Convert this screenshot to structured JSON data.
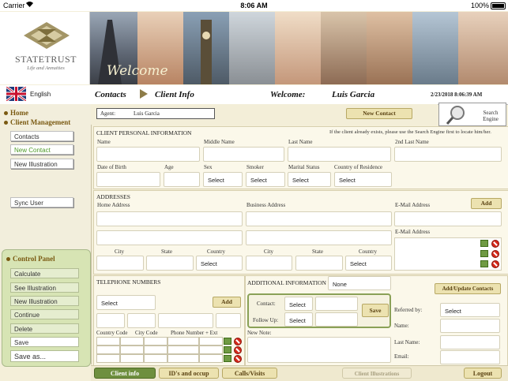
{
  "status_bar": {
    "carrier": "Carrier",
    "time": "8:06 AM",
    "battery": "100%"
  },
  "logo": {
    "name": "STATETRUST",
    "tagline": "Life and Annuities"
  },
  "banner": {
    "welcome_text": "Welcome"
  },
  "topbar": {
    "language": "English",
    "breadcrumb_1": "Contacts",
    "breadcrumb_2": "Client Info",
    "welcome_label": "Welcome:",
    "user_name": "Luis Garcia",
    "datetime": "2/23/2018 8:06:39 AM"
  },
  "sidebar": {
    "home": "Home",
    "client_management": "Client Management",
    "items": [
      "Contacts",
      "New Contact",
      "New Illustration"
    ],
    "sync_user": "Sync User"
  },
  "control_panel": {
    "title": "Control Panel",
    "items": [
      "Calculate",
      "See Illustration",
      "New Illustration",
      "Continue",
      "Delete",
      "Save",
      "Save as..."
    ]
  },
  "agent": {
    "label": "Agent:",
    "value": "Luis Garcia"
  },
  "buttons": {
    "new_contact": "New Contact",
    "search_engine": "Search Engine",
    "add_address": "Add",
    "add_phone": "Add",
    "save_followup": "Save",
    "add_update_contacts": "Add/Update Contacts"
  },
  "personal_info": {
    "title": "CLIENT PERSONAL INFORMATION",
    "note": "If the client already exists, please use the Search Engine first to locate him/her.",
    "name": "Name",
    "middle_name": "Middle Name",
    "last_name": "Last Name",
    "second_last_name": "2nd Last Name",
    "dob": "Date of Birth",
    "age": "Age",
    "sex": "Sex",
    "smoker": "Smoker",
    "marital_status": "Marital Status",
    "country_residence": "Country of Residence",
    "select": "Select"
  },
  "addresses": {
    "title": "ADDRESSES",
    "home_address": "Home Address",
    "business_address": "Business Address",
    "email_address_1": "E-Mail Address",
    "email_address_2": "E-Mail Address",
    "city": "City",
    "state": "State",
    "country": "Country",
    "select": "Select"
  },
  "telephone": {
    "title": "TELEPHONE NUMBERS",
    "select": "Select",
    "country_code": "Country Code",
    "city_code": "City Code",
    "phone_ext": "Phone Number + Ext"
  },
  "additional": {
    "title": "ADDITIONAL INFORMATION",
    "value": "None",
    "contact_label": "Contact:",
    "contact_value": "Select",
    "followup_label": "Follow Up:",
    "followup_value": "Select",
    "new_note": "New Note:"
  },
  "referral": {
    "referred_by": "Referred by:",
    "referred_value": "Select",
    "name": "Name:",
    "last_name": "Last Name:",
    "email": "Email:"
  },
  "tabs": [
    "Client info",
    "ID's and occup",
    "Calls/Visits",
    "Client Illustrations",
    "Logout"
  ],
  "colors": {
    "accent_brown": "#7a5a12",
    "tab_green": "#6e8f3e",
    "panel_green": "#d7e4b4"
  }
}
